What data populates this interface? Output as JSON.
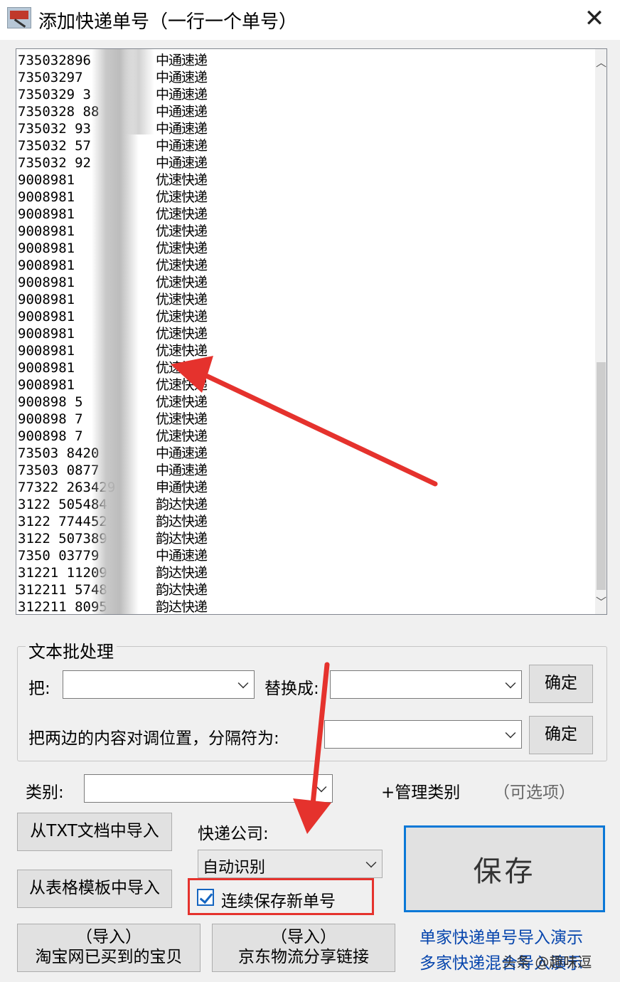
{
  "window": {
    "title": "添加快递单号（一行一个单号）",
    "close_glyph": "✕",
    "icon": "app-icon"
  },
  "list": {
    "rows": [
      {
        "num": "735032896",
        "co": "中通速递"
      },
      {
        "num": "73503297",
        "co": "中通速递"
      },
      {
        "num": "7350329        3",
        "co": "中通速递"
      },
      {
        "num": "7350328        88",
        "co": "中通速递"
      },
      {
        "num": "735032         93",
        "co": "中通速递"
      },
      {
        "num": "735032         57",
        "co": "中通速递"
      },
      {
        "num": "735032         92",
        "co": "中通速递"
      },
      {
        "num": "9008981",
        "co": "优速快递"
      },
      {
        "num": "9008981",
        "co": "优速快递"
      },
      {
        "num": "9008981",
        "co": "优速快递"
      },
      {
        "num": "9008981",
        "co": "优速快递"
      },
      {
        "num": "9008981",
        "co": "优速快递"
      },
      {
        "num": "9008981",
        "co": "优速快递"
      },
      {
        "num": "9008981",
        "co": "优速快递"
      },
      {
        "num": "9008981",
        "co": "优速快递"
      },
      {
        "num": "9008981",
        "co": "优速快递"
      },
      {
        "num": "9008981",
        "co": "优速快递"
      },
      {
        "num": "9008981",
        "co": "优速快递"
      },
      {
        "num": "9008981",
        "co": "优速快递"
      },
      {
        "num": "9008981",
        "co": "优速快递"
      },
      {
        "num": "900898        5",
        "co": "优速快递"
      },
      {
        "num": "900898        7",
        "co": "优速快递"
      },
      {
        "num": "900898        7",
        "co": "优速快递"
      },
      {
        "num": "73503      8420",
        "co": "中通速递"
      },
      {
        "num": "73503      0877",
        "co": "中通速递"
      },
      {
        "num": "77322      263429",
        "co": "申通快递"
      },
      {
        "num": "3122       505484",
        "co": "韵达快递"
      },
      {
        "num": "3122       774452",
        "co": "韵达快递"
      },
      {
        "num": "3122       507389",
        "co": "韵达快递"
      },
      {
        "num": "7350       03779",
        "co": "中通速递"
      },
      {
        "num": "31221      11209",
        "co": "韵达快递"
      },
      {
        "num": "312211     5748",
        "co": "韵达快递"
      },
      {
        "num": "312211     8095",
        "co": "韵达快递"
      }
    ]
  },
  "batch": {
    "group_title": "文本批处理",
    "replace_from_label": "把:",
    "replace_to_label": "替换成:",
    "confirm1": "确定",
    "swap_label": "把两边的内容对调位置，分隔符为:",
    "confirm2": "确定"
  },
  "category": {
    "label": "类别:",
    "manage": "+管理类别",
    "optional": "（可选项）"
  },
  "import": {
    "txt": "从TXT文档中导入",
    "table": "从表格模板中导入",
    "taobao_line1": "（导入）",
    "taobao_line2": "淘宝网已买到的宝贝",
    "jd_line1": "（导入）",
    "jd_line2": "京东物流分享链接"
  },
  "courier": {
    "label": "快递公司:",
    "selected": "自动识别"
  },
  "continuous_save": {
    "label": "连续保存新单号",
    "checked": true
  },
  "save": {
    "label": "保存"
  },
  "links": {
    "single": "单家快递单号导入演示",
    "multi": "多家快递混合导入演示"
  },
  "watermark": "头条 @趣味逗",
  "colors": {
    "accent": "#0a78d7",
    "highlight": "#e5322d",
    "link": "#0645ad"
  }
}
